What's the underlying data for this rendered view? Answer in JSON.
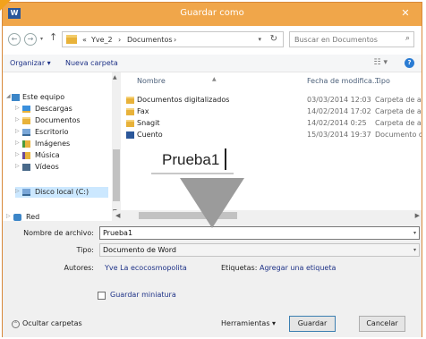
{
  "window": {
    "title": "Guardar como",
    "app_icon": "word-icon",
    "close": "✕"
  },
  "nav": {
    "back": "←",
    "forward": "→",
    "up": "↑"
  },
  "address": {
    "crumbs": [
      "«",
      "Yve_2",
      "›",
      "Documentos",
      "›"
    ],
    "refresh": "↻"
  },
  "search": {
    "placeholder": "Buscar en Documentos"
  },
  "toolbar": {
    "organize": "Organizar ▾",
    "new_folder": "Nueva carpeta"
  },
  "sidebar": {
    "items": [
      {
        "label": "Este equipo",
        "icon": "computer-icon"
      },
      {
        "label": "Descargas",
        "icon": "downloads-icon"
      },
      {
        "label": "Documentos",
        "icon": "documents-folder-icon"
      },
      {
        "label": "Escritorio",
        "icon": "desktop-folder-icon"
      },
      {
        "label": "Imágenes",
        "icon": "pictures-folder-icon"
      },
      {
        "label": "Música",
        "icon": "music-folder-icon"
      },
      {
        "label": "Vídeos",
        "icon": "videos-folder-icon"
      },
      {
        "label": "Disco local (C:)",
        "icon": "disk-icon"
      },
      {
        "label": "Red",
        "icon": "network-icon"
      }
    ]
  },
  "files": {
    "columns": {
      "name": "Nombre",
      "date": "Fecha de modifica...",
      "type": "Tipo"
    },
    "rows": [
      {
        "name": "Documentos digitalizados",
        "date": "03/03/2014 12:03",
        "type": "Carpeta de archivos",
        "icon": "folder-icon"
      },
      {
        "name": "Fax",
        "date": "14/02/2014 17:02",
        "type": "Carpeta de archivos",
        "icon": "folder-icon"
      },
      {
        "name": "Snagit",
        "date": "14/02/2014 0:25",
        "type": "Carpeta de archivos",
        "icon": "folder-icon"
      },
      {
        "name": "Cuento",
        "date": "15/03/2014 19:37",
        "type": "Documento de Microsoft Word",
        "icon": "word-doc-icon"
      }
    ]
  },
  "callout": {
    "text": "Prueba1"
  },
  "form": {
    "filename_label": "Nombre de archivo:",
    "filename_value": "Prueba1",
    "type_label": "Tipo:",
    "type_value": "Documento de Word",
    "authors_label": "Autores:",
    "authors_value": "Yve La ecocosmopolita",
    "tags_label": "Etiquetas:",
    "tags_value": "Agregar una etiqueta",
    "thumbnail_label": "Guardar miniatura"
  },
  "footer": {
    "hide_folders": "Ocultar carpetas",
    "tools": "Herramientas ▾",
    "save": "Guardar",
    "cancel": "Cancelar"
  }
}
